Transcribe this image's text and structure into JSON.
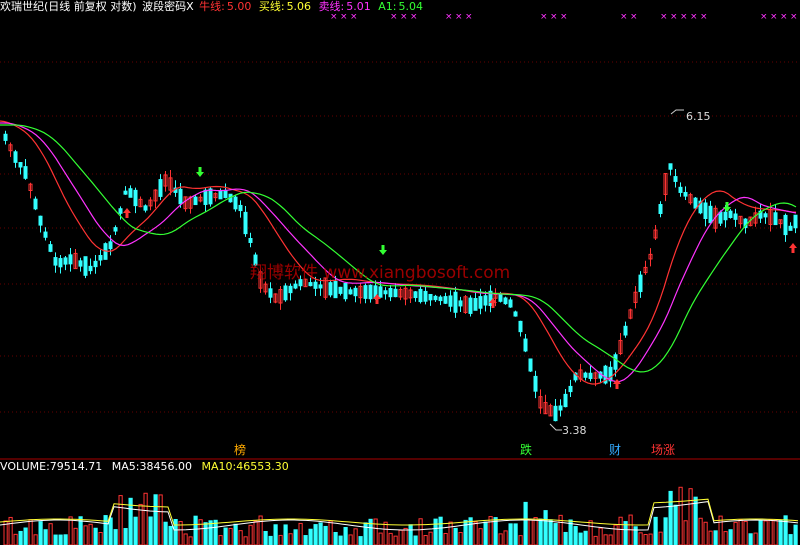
{
  "header": {
    "title": "欢瑞世纪(日线 前复权 对数)",
    "indicator": "波段密码X",
    "indicators": [
      {
        "label": "牛线:",
        "value": "5.00",
        "color": "#ff3333"
      },
      {
        "label": "买线:",
        "value": "5.06",
        "color": "#ffff33"
      },
      {
        "label": "卖线:",
        "value": "5.01",
        "color": "#ff33ff"
      },
      {
        "label": "A1:",
        "value": "5.04",
        "color": "#33ff33"
      }
    ],
    "title_color": "#ffffff"
  },
  "price_panel": {
    "high_label": "6.15",
    "low_label": "3.38",
    "watermark": "翔博软件 www.xiangbosoft.com",
    "events": [
      {
        "text": "榜",
        "color": "#ffaa00"
      },
      {
        "text": "跌",
        "color": "#33ff33"
      },
      {
        "text": "财",
        "color": "#33aaff"
      },
      {
        "text": "场涨",
        "color": "#ff3333"
      }
    ],
    "colors": {
      "up": "#ff3333",
      "down": "#33ffff",
      "ma_green": "#33ff33",
      "ma_magenta": "#ff33ff",
      "ma_red": "#ff3333",
      "buy_arrow": "#33ff33",
      "sell_arrow": "#ff3333",
      "marker": "#ff33ff",
      "grid": "#660000"
    }
  },
  "volume_panel": {
    "label": "VOLUME:",
    "volume": "79514.71",
    "ma5_label": "MA5:",
    "ma5": "38456.00",
    "ma10_label": "MA10:",
    "ma10": "46553.30",
    "colors": {
      "label": "#ffffff",
      "ma5": "#ffffff",
      "ma10": "#ffff33"
    }
  },
  "chart_data": {
    "type": "candlestick",
    "price_extremes": {
      "high": 6.15,
      "low": 3.38
    },
    "ma_lines": [
      {
        "name": "牛线",
        "last": 5.0
      },
      {
        "name": "买线",
        "last": 5.06
      },
      {
        "name": "卖线",
        "last": 5.01
      },
      {
        "name": "A1",
        "last": 5.04
      }
    ],
    "volume": {
      "last": 79514.71,
      "ma5": 38456.0,
      "ma10": 46553.3
    }
  }
}
